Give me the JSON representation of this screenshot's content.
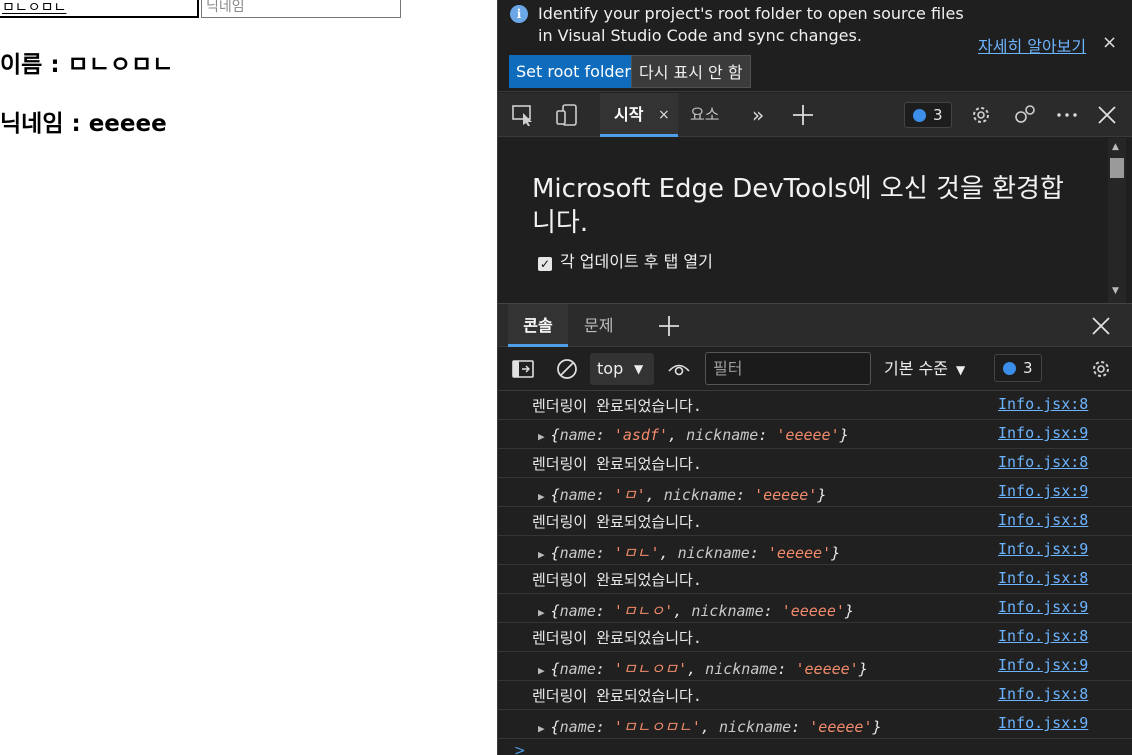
{
  "page": {
    "name_input_value": "ㅁㄴㅇㅁㄴ",
    "nickname_placeholder": "닉네임",
    "name_line": "이름 : ㅁㄴㅇㅁㄴ",
    "nickname_line": "닉네임 : eeeee"
  },
  "infobar": {
    "text": "Identify your project's root folder to open source files in Visual Studio Code and sync changes.",
    "learn_more": "자세히 알아보기",
    "close": "×",
    "set_root_folder": "Set root folder",
    "dont_show_again": "다시 표시 안 함"
  },
  "toolbar": {
    "tab_start": "시작",
    "tab_start_close": "×",
    "tab_elements": "요소",
    "more_tabs": "»",
    "issues_count": "3"
  },
  "welcome": {
    "title": "Microsoft Edge DevTools에 오신 것을 환경합니다.",
    "open_after_update": "각 업데이트 후 탭 열기"
  },
  "drawer": {
    "tab_console": "콘솔",
    "tab_issues": "문제"
  },
  "console_toolbar": {
    "context": "top",
    "filter_placeholder": "필터",
    "levels": "기본 수준",
    "issues_count": "3"
  },
  "logs": [
    {
      "type": "msg",
      "text": "렌더링이 완료되었습니다.",
      "src": "Info.jsx:8"
    },
    {
      "type": "obj",
      "name": "'asdf'",
      "nickname": "'eeeee'",
      "src": "Info.jsx:9"
    },
    {
      "type": "msg",
      "text": "렌더링이 완료되었습니다.",
      "src": "Info.jsx:8"
    },
    {
      "type": "obj",
      "name": "'ㅁ'",
      "nickname": "'eeeee'",
      "src": "Info.jsx:9"
    },
    {
      "type": "msg",
      "text": "렌더링이 완료되었습니다.",
      "src": "Info.jsx:8"
    },
    {
      "type": "obj",
      "name": "'ㅁㄴ'",
      "nickname": "'eeeee'",
      "src": "Info.jsx:9"
    },
    {
      "type": "msg",
      "text": "렌더링이 완료되었습니다.",
      "src": "Info.jsx:8"
    },
    {
      "type": "obj",
      "name": "'ㅁㄴㅇ'",
      "nickname": "'eeeee'",
      "src": "Info.jsx:9"
    },
    {
      "type": "msg",
      "text": "렌더링이 완료되었습니다.",
      "src": "Info.jsx:8"
    },
    {
      "type": "obj",
      "name": "'ㅁㄴㅇㅁ'",
      "nickname": "'eeeee'",
      "src": "Info.jsx:9"
    },
    {
      "type": "msg",
      "text": "렌더링이 완료되었습니다.",
      "src": "Info.jsx:8"
    },
    {
      "type": "obj",
      "name": "'ㅁㄴㅇㅁㄴ'",
      "nickname": "'eeeee'",
      "src": "Info.jsx:9"
    }
  ],
  "labels": {
    "name_key": "name",
    "nickname_key": "nickname",
    "prompt": ">"
  }
}
